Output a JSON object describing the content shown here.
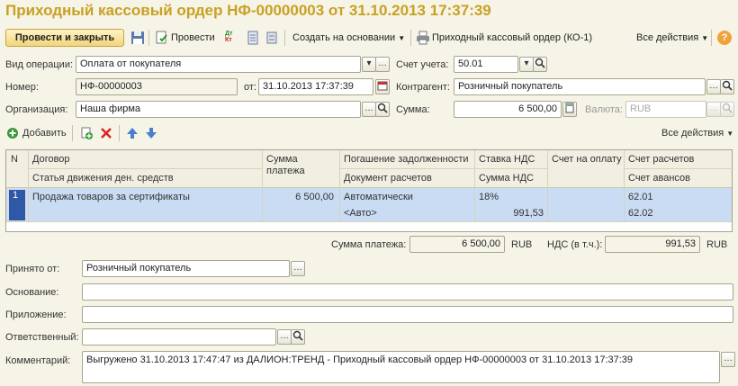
{
  "window": {
    "title": "Приходный кассовый ордер НФ-00000003 от 31.10.2013 17:37:39"
  },
  "toolbar": {
    "post_close": "Провести и закрыть",
    "post": "Провести",
    "create_based": "Создать на основании",
    "print_form": "Приходный кассовый ордер (КО-1)",
    "all_actions": "Все действия",
    "help": "?",
    "dt_kt": "Дт Кт"
  },
  "form": {
    "operation_label": "Вид операции:",
    "operation_value": "Оплата от покупателя",
    "account_label": "Счет учета:",
    "account_value": "50.01",
    "number_label": "Номер:",
    "number_value": "НФ-00000003",
    "date_label": "от:",
    "date_value": "31.10.2013 17:37:39",
    "counterparty_label": "Контрагент:",
    "counterparty_value": "Розничный покупатель",
    "org_label": "Организация:",
    "org_value": "Наша фирма",
    "sum_label": "Сумма:",
    "sum_value": "6 500,00",
    "currency_label": "Валюта:",
    "currency_value": "RUB"
  },
  "table_toolbar": {
    "add": "Добавить",
    "all_actions": "Все действия"
  },
  "table": {
    "headers": {
      "n": "N",
      "contract": "Договор",
      "cash_flow": "Статья движения ден. средств",
      "payment_sum": "Сумма платежа",
      "repayment": "Погашение задолженности",
      "settlement_doc": "Документ расчетов",
      "vat_rate": "Ставка НДС",
      "vat_sum": "Сумма НДС",
      "invoice": "Счет на оплату",
      "settle_account": "Счет расчетов",
      "advance_account": "Счет авансов"
    },
    "rows": [
      {
        "n": "1",
        "contract": "Продажа товаров за сертификаты",
        "cash_flow": "",
        "payment_sum": "6 500,00",
        "repayment": "Автоматически",
        "settlement_doc": "<Авто>",
        "vat_rate": "18%",
        "vat_sum": "991,53",
        "invoice": "",
        "settle_account": "62.01",
        "advance_account": "62.02"
      }
    ]
  },
  "totals": {
    "payment_label": "Сумма платежа:",
    "payment_value": "6 500,00",
    "payment_currency": "RUB",
    "vat_label": "НДС (в т.ч.):",
    "vat_value": "991,53",
    "vat_currency": "RUB"
  },
  "footer": {
    "received_from_label": "Принято от:",
    "received_from_value": "Розничный покупатель",
    "basis_label": "Основание:",
    "basis_value": "",
    "attachment_label": "Приложение:",
    "attachment_value": "",
    "responsible_label": "Ответственный:",
    "responsible_value": "",
    "comment_label": "Комментарий:",
    "comment_value": "Выгружено 31.10.2013 17:47:47 из ДАЛИОН:ТРЕНД - Приходный кассовый ордер НФ-00000003 от 31.10.2013 17:37:39"
  },
  "icons": {
    "save": "floppy-disk-icon",
    "post": "post-document-icon",
    "dt_kt": "debit-credit-icon",
    "report": "report-list-icon",
    "print": "printer-icon",
    "add": "plus-circle-icon",
    "copy": "copy-add-icon",
    "delete": "red-x-icon",
    "up": "arrow-up-icon",
    "down": "arrow-down-icon"
  },
  "colors": {
    "title": "#c8a024",
    "background": "#f6f4e6",
    "row_selected": "#c9dcf3",
    "row_marker": "#2f59a6"
  }
}
